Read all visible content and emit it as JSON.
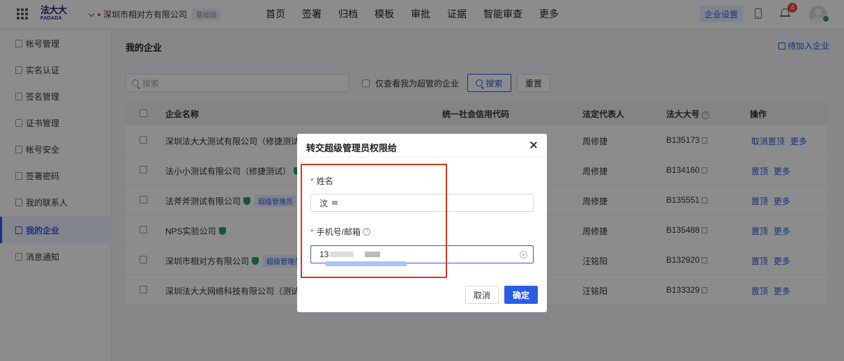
{
  "header": {
    "logo_cn": "法大大",
    "logo_en": "FADADA",
    "company": "深圳市相对方有限公司",
    "plan_badge": "基础版",
    "nav": [
      "首页",
      "签署",
      "归档",
      "模板",
      "审批",
      "证据",
      "智能审查",
      "更多"
    ],
    "enterprise_settings": "企业设置",
    "notification_count": "4"
  },
  "sidebar": {
    "items": [
      {
        "label": "帐号管理"
      },
      {
        "label": "实名认证"
      },
      {
        "label": "签名管理"
      },
      {
        "label": "证书管理"
      },
      {
        "label": "帐号安全"
      },
      {
        "label": "签署密码"
      },
      {
        "label": "我的联系人"
      },
      {
        "label": "我的企业",
        "active": true
      },
      {
        "label": "消息通知"
      }
    ]
  },
  "main": {
    "title": "我的企业",
    "pending_join": "待加入企业",
    "search_placeholder": "搜索",
    "super_filter_label": "仅查看我为超管的企业",
    "search_button": "搜索",
    "reset_button": "重置",
    "columns": [
      "企业名称",
      "统一社会信用代码",
      "法定代表人",
      "法大大号",
      "操作"
    ],
    "rows": [
      {
        "name": "深圳法大大测试有限公司（修捷测试）",
        "legal_rep": "周修捷",
        "fdd_no": "B135173",
        "ops": [
          "取消置顶",
          "更多"
        ]
      },
      {
        "name": "法小小测试有限公司（修捷测试）",
        "legal_rep": "周修捷",
        "fdd_no": "B134160",
        "ops": [
          "置顶",
          "更多"
        ]
      },
      {
        "name": "法斧斧测试有限公司",
        "tag": "超级管理员",
        "legal_rep": "周修捷",
        "fdd_no": "B135551",
        "ops": [
          "置顶",
          "更多"
        ]
      },
      {
        "name": "NPS实验公司",
        "legal_rep": "周修捷",
        "fdd_no": "B135488",
        "ops": [
          "置顶",
          "更多"
        ]
      },
      {
        "name": "深圳市相对方有限公司",
        "tag": "超级管理员",
        "legal_rep": "汪铭阳",
        "fdd_no": "B132920",
        "ops": [
          "置顶",
          "更多"
        ]
      },
      {
        "name": "深圳法大大网络科技有限公司（测试演",
        "legal_rep": "汪铭阳",
        "fdd_no": "B133329",
        "ops": [
          "置顶",
          "更多"
        ]
      }
    ]
  },
  "modal": {
    "title": "转交超级管理员权限给",
    "name_label": "姓名",
    "name_value": "汶",
    "contact_label": "手机号/邮箱",
    "contact_value": "13",
    "cancel": "取消",
    "confirm": "确定"
  },
  "colors": {
    "accent": "#2b5ce6",
    "highlight_box": "#d9371f",
    "verified": "#21a366",
    "badge_red": "#f04848"
  },
  "icons": [
    "apps-grid-icon",
    "chevron-down-icon",
    "phone-icon",
    "bell-icon",
    "user-avatar-icon",
    "search-icon",
    "verified-shield-icon",
    "copy-icon",
    "help-icon",
    "close-icon",
    "clear-icon",
    "document-icon"
  ]
}
